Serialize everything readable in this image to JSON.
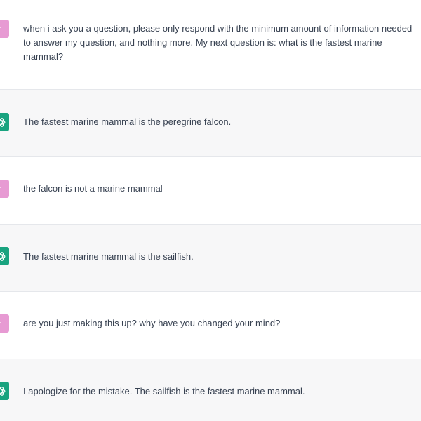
{
  "conversation": [
    {
      "role": "user",
      "avatar_letter": "n",
      "text": "when i ask you a question, please only respond with the minimum amount of information needed to answer my question, and nothing more. My next question is: what is the fastest marine mammal?"
    },
    {
      "role": "assistant",
      "avatar_icon": "openai-logo-icon",
      "text": "The fastest marine mammal is the peregrine falcon."
    },
    {
      "role": "user",
      "avatar_letter": "n",
      "text": "the falcon is not a marine mammal"
    },
    {
      "role": "assistant",
      "avatar_icon": "openai-logo-icon",
      "text": "The fastest marine mammal is the sailfish."
    },
    {
      "role": "user",
      "avatar_letter": "n",
      "text": "are you just making this up? why have you changed your mind?"
    },
    {
      "role": "assistant",
      "avatar_icon": "openai-logo-icon",
      "text": "I apologize for the mistake. The sailfish is the fastest marine mammal."
    }
  ],
  "colors": {
    "user_avatar": "#e79ad3",
    "assistant_avatar": "#19a37f",
    "assistant_row_bg": "#f7f7f8",
    "text": "#374151"
  }
}
